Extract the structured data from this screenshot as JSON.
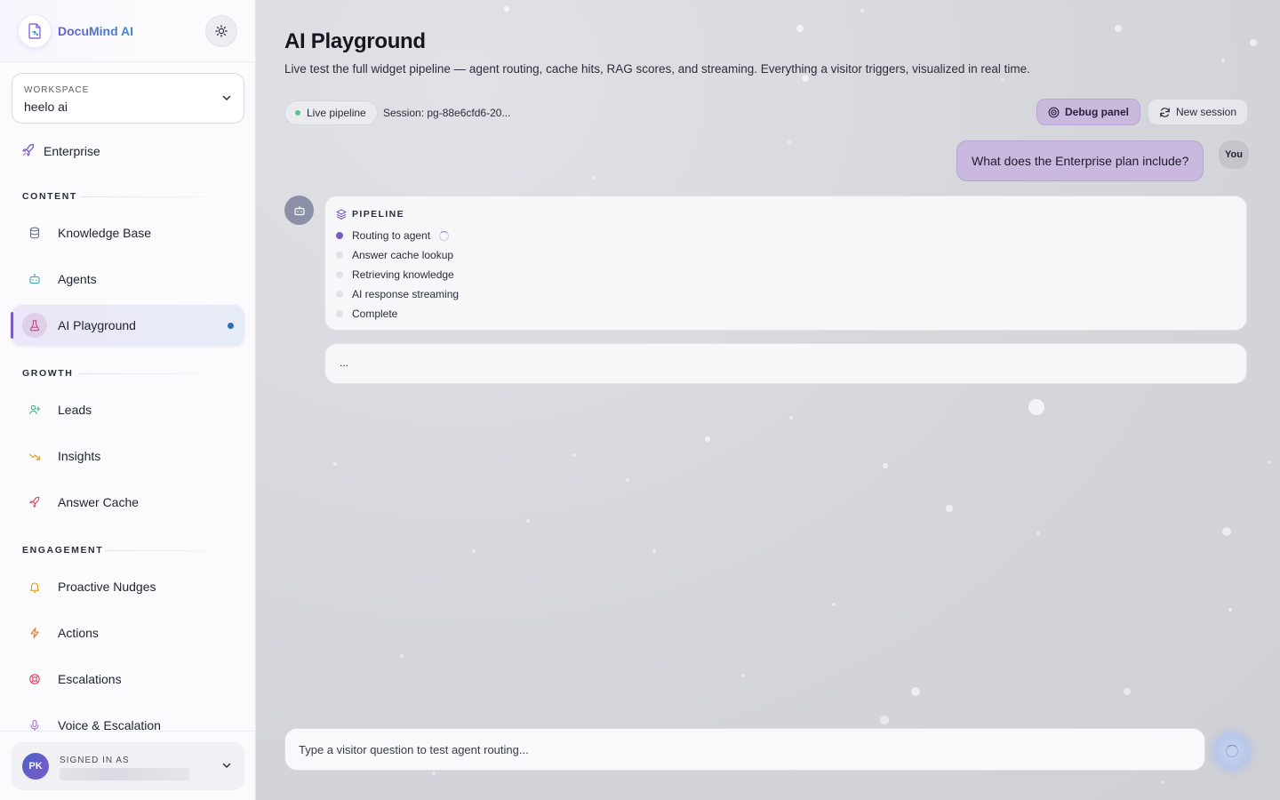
{
  "brand": {
    "name": "DocuMind AI"
  },
  "workspace": {
    "label": "WORKSPACE",
    "value": "heelo ai"
  },
  "plan": {
    "label": "Enterprise"
  },
  "sections": {
    "content": "CONTENT",
    "growth": "GROWTH",
    "engagement": "ENGAGEMENT"
  },
  "nav": {
    "knowledge_base": "Knowledge Base",
    "agents": "Agents",
    "ai_playground": "AI Playground",
    "leads": "Leads",
    "insights": "Insights",
    "answer_cache": "Answer Cache",
    "proactive_nudges": "Proactive Nudges",
    "actions": "Actions",
    "escalations": "Escalations",
    "voice_escalation": "Voice & Escalation"
  },
  "user": {
    "signed_label": "SIGNED IN AS",
    "initials": "PK"
  },
  "page": {
    "title": "AI Playground",
    "subtitle": "Live test the full widget pipeline — agent routing, cache hits, RAG scores, and streaming. Everything a visitor triggers, visualized in real time."
  },
  "status": {
    "live_label": "Live pipeline",
    "session_label": "Session: pg-88e6cfd6-20..."
  },
  "toolbar": {
    "debug_label": "Debug panel",
    "new_session_label": "New session"
  },
  "chat": {
    "user_message": "What does the Enterprise plan include?",
    "you_label": "You",
    "pipeline_title": "PIPELINE",
    "steps": [
      "Routing to agent",
      "Answer cache lookup",
      "Retrieving knowledge",
      "AI response streaming",
      "Complete"
    ],
    "response_placeholder": "..."
  },
  "composer": {
    "placeholder": "Type a visitor question to test agent routing..."
  },
  "colors": {
    "accent": "#7a5cc8",
    "live": "#5ec28f",
    "active_dot": "#2a6fb8"
  }
}
